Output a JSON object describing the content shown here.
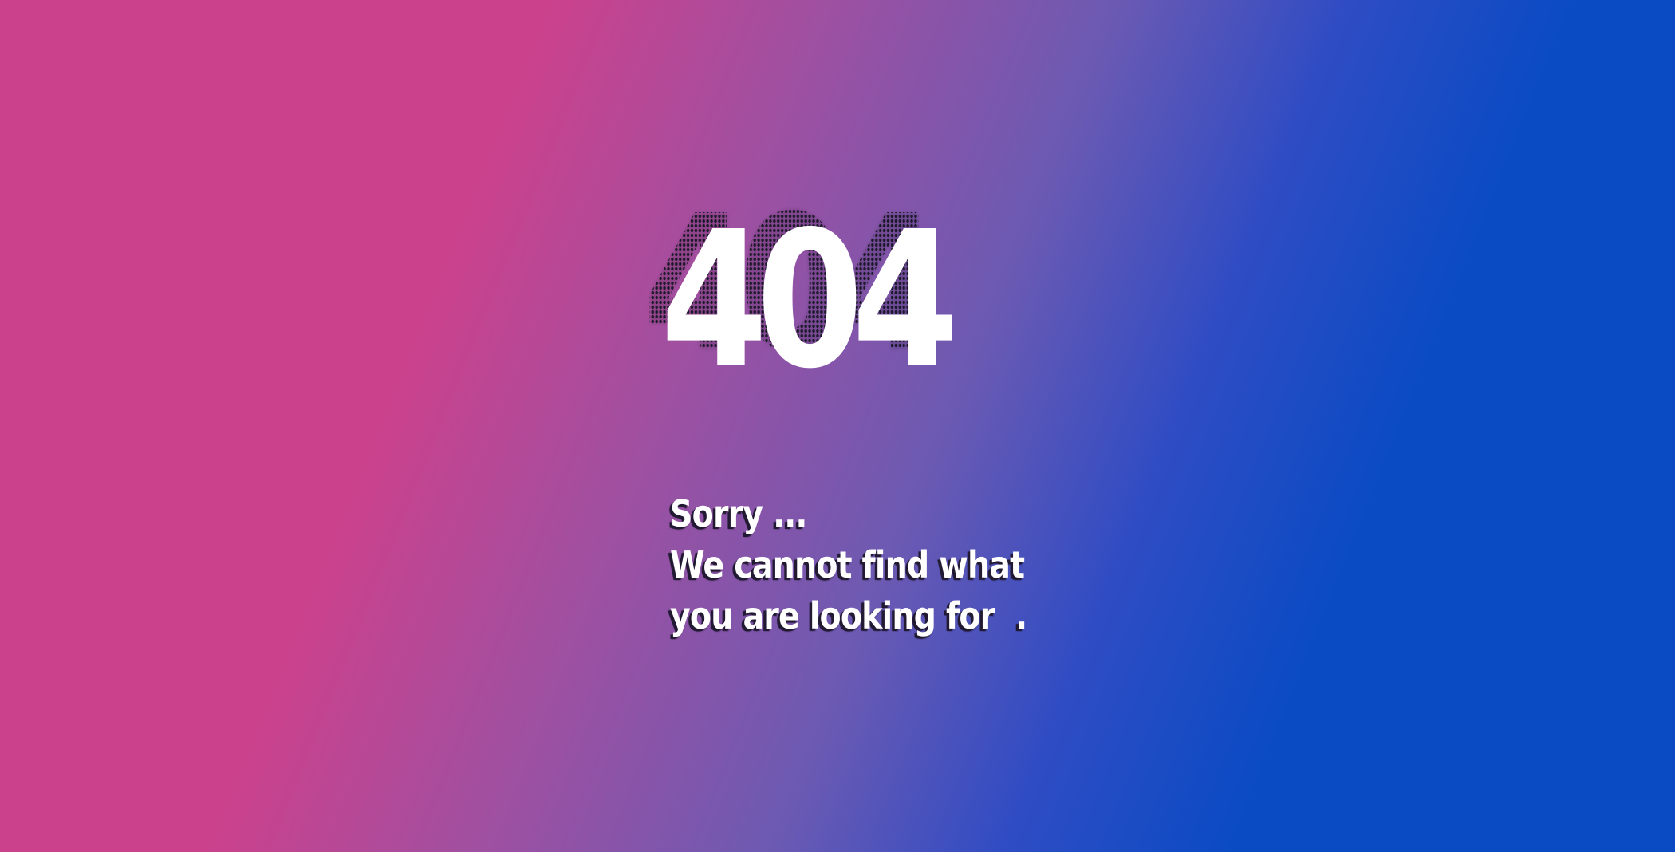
{
  "error": {
    "code": "404",
    "lines": [
      "Sorry ...",
      "We cannot find what",
      "you are looking for  ."
    ]
  },
  "colors": {
    "gradient_left": "#cc418c",
    "gradient_mid": "#6d5ab2",
    "gradient_right": "#0a4bc4",
    "text": "#ffffff",
    "shadow": "#1c1a2a"
  }
}
